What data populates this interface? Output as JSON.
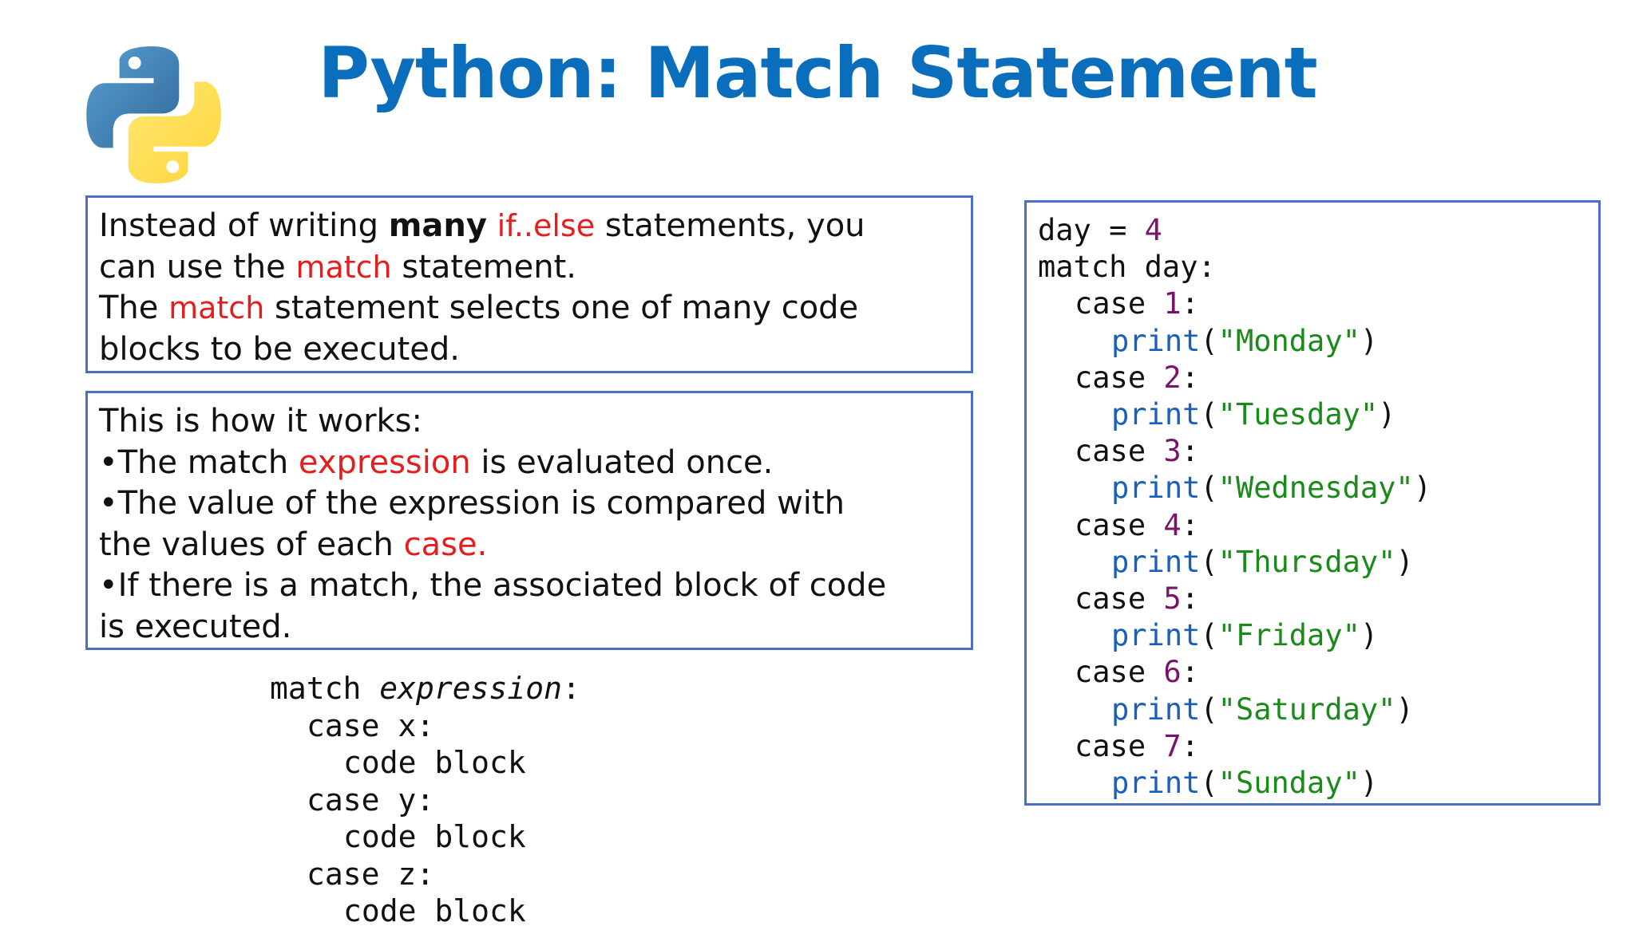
{
  "title": "Python: Match Statement",
  "intro": {
    "p1_a": "Instead of writing ",
    "p1_bold": "many",
    "p1_red": "if..else",
    "p1_b": " statements, you",
    "p2_a": "can use the ",
    "p2_red": "match",
    "p2_b": " statement.",
    "p3_a": "The ",
    "p3_red": "match",
    "p3_b": " statement selects one of many code",
    "p4": "blocks to be executed."
  },
  "how": {
    "l1": "This is how it works:",
    "l2_a": "•The match ",
    "l2_red": "expression",
    "l2_b": " is evaluated once.",
    "l3": "•The value of the expression is compared with",
    "l4_a": "the values of each ",
    "l4_red": "case.",
    "l5": "•If there is a match, the associated block of code",
    "l6": "is executed."
  },
  "syntax": {
    "match_kw": "match ",
    "expr": "expression",
    "colon": ":",
    "case_x": "case x:",
    "code1": "code block",
    "case_y": "case y:",
    "code2": "code block",
    "case_z": "case z:",
    "code3": "code block"
  },
  "example": {
    "line1_var": "day = ",
    "line1_val": "4",
    "line2": "match day:",
    "cases": [
      {
        "num": "1",
        "day": "\"Monday\""
      },
      {
        "num": "2",
        "day": "\"Tuesday\""
      },
      {
        "num": "3",
        "day": "\"Wednesday\""
      },
      {
        "num": "4",
        "day": "\"Thursday\""
      },
      {
        "num": "5",
        "day": "\"Friday\""
      },
      {
        "num": "6",
        "day": "\"Saturday\""
      },
      {
        "num": "7",
        "day": "\"Sunday\""
      }
    ],
    "case_kw": "case ",
    "print_kw": "print",
    "colors": {
      "number": "#7a1468",
      "keyword": "#1a5fb8",
      "string": "#1a8a1a"
    }
  },
  "colors": {
    "title": "#0a6ebd",
    "highlight": "#e41e1e",
    "border": "#4a6fc4"
  }
}
